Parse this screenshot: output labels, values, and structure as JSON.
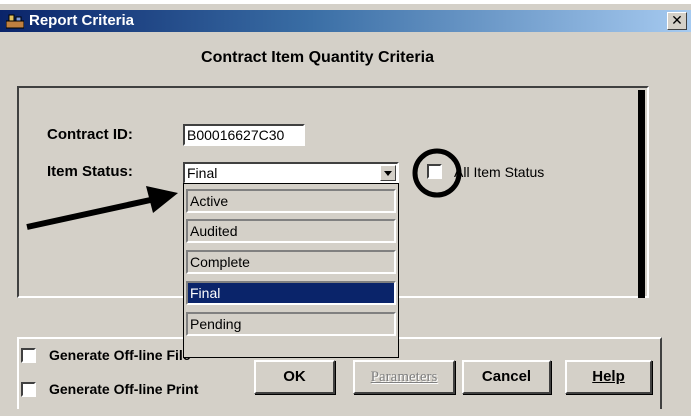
{
  "window": {
    "title": "Report Criteria",
    "close_glyph": "✕"
  },
  "heading": "Contract Item Quantity Criteria",
  "form": {
    "contract_id_label": "Contract ID:",
    "contract_id_value": "B00016627C30",
    "item_status_label": "Item Status:",
    "item_status_value": "Final",
    "all_item_status_label": "All Item Status",
    "all_item_status_checked": false
  },
  "dropdown": {
    "options": [
      "Active",
      "Audited",
      "Complete",
      "Final",
      "Pending"
    ],
    "selected": "Final"
  },
  "output": {
    "offline_file_label": "Generate Off-line File",
    "offline_print_label": "Generate Off-line Print"
  },
  "buttons": {
    "ok": "OK",
    "parameters": "Parameters",
    "cancel": "Cancel",
    "help": "Help"
  },
  "annotations": {
    "arrow_color": "#000000",
    "circle_color": "#000000"
  },
  "icons": [
    "app-icon",
    "close-icon",
    "dropdown-arrow-icon"
  ]
}
